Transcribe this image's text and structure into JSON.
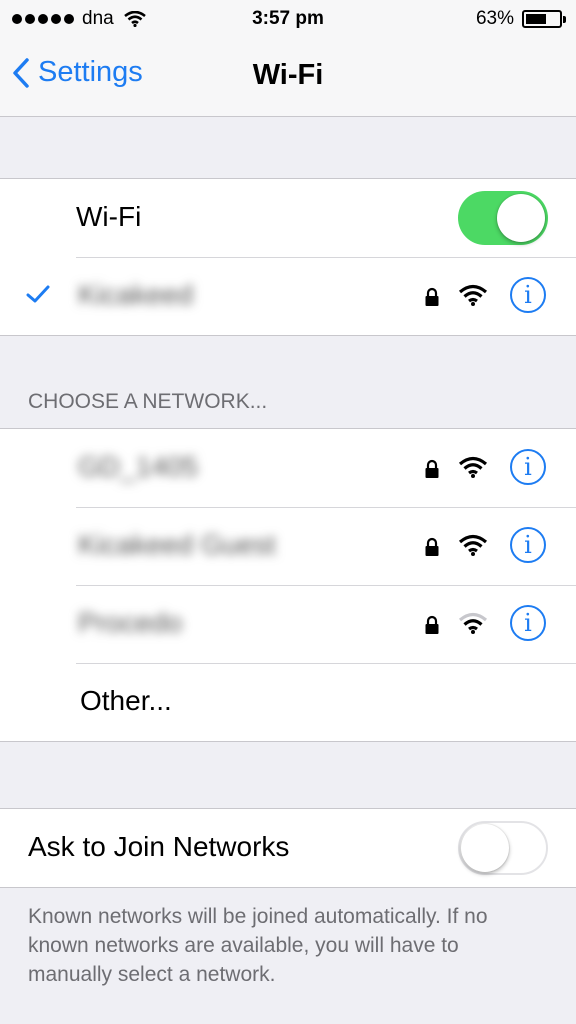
{
  "status_bar": {
    "carrier": "dna",
    "time": "3:57 pm",
    "battery_percent": "63%",
    "battery_level": 0.63,
    "signal_dots": 5
  },
  "nav": {
    "back_label": "Settings",
    "title": "Wi-Fi"
  },
  "wifi_toggle": {
    "label": "Wi-Fi",
    "on": true
  },
  "connected_network": {
    "name": "Kicakeed",
    "secured": true,
    "signal_bars": 3
  },
  "choose_network_header": "CHOOSE A NETWORK...",
  "networks": [
    {
      "name": "GD_1405",
      "secured": true,
      "signal_bars": 3
    },
    {
      "name": "Kicakeed Guest",
      "secured": true,
      "signal_bars": 3
    },
    {
      "name": "Procedo",
      "secured": true,
      "signal_bars": 2
    }
  ],
  "other_label": "Other...",
  "ask_to_join": {
    "label": "Ask to Join Networks",
    "on": false
  },
  "footer_text": "Known networks will be joined automatically. If no known networks are available, you will have to manually select a network.",
  "colors": {
    "accent": "#1d7cf2",
    "toggle_on": "#4cd964",
    "background": "#efeff4"
  }
}
